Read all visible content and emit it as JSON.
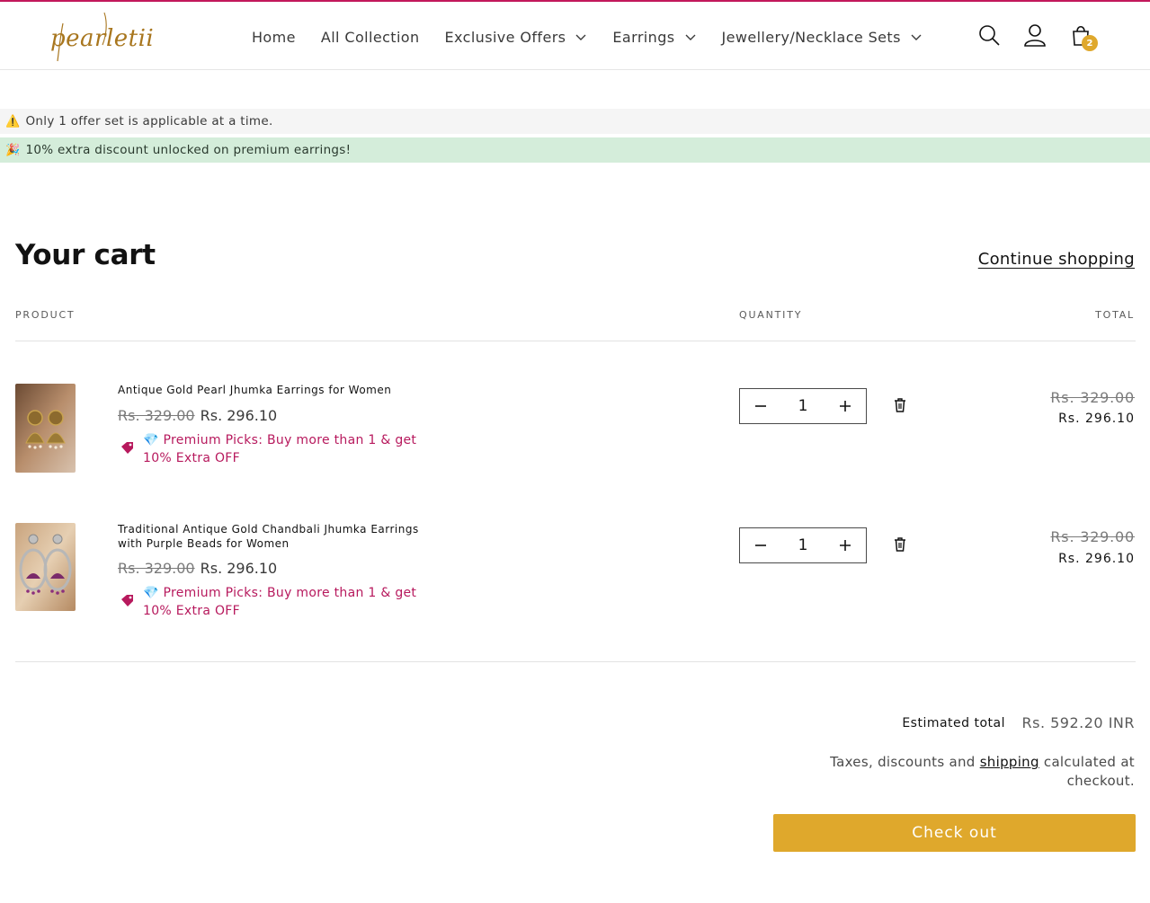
{
  "brand": {
    "logo_text": "pearletii",
    "accent": "#dfa82c",
    "promo_color": "#b7195d",
    "top_bar_color": "#c2185b"
  },
  "nav": {
    "items": [
      {
        "label": "Home",
        "has_dropdown": false
      },
      {
        "label": "All Collection",
        "has_dropdown": false
      },
      {
        "label": "Exclusive Offers",
        "has_dropdown": true
      },
      {
        "label": "Earrings",
        "has_dropdown": true
      },
      {
        "label": "Jewellery/Necklace Sets",
        "has_dropdown": true
      }
    ]
  },
  "header_icons": {
    "search": "search-icon",
    "account": "account-icon",
    "cart": "cart-icon",
    "cart_count": "2"
  },
  "notices": {
    "warning": {
      "emoji": "⚠️",
      "text": "Only 1 offer set is applicable at a time."
    },
    "success": {
      "emoji": "🎉",
      "text": "10% extra discount unlocked on premium earrings!"
    }
  },
  "cart": {
    "title": "Your cart",
    "continue_label": "Continue shopping",
    "columns": {
      "product": "PRODUCT",
      "quantity": "QUANTITY",
      "total": "TOTAL"
    },
    "items": [
      {
        "name": "Antique Gold Pearl Jhumka Earrings for Women",
        "compare_price": "Rs. 329.00",
        "price": "Rs. 296.10",
        "promo": "💎 Premium Picks: Buy more than 1 & get 10% Extra OFF",
        "quantity": "1",
        "total_old": "Rs. 329.00",
        "total_new": "Rs. 296.10"
      },
      {
        "name": "Traditional Antique Gold Chandbali Jhumka Earrings with Purple Beads for Women",
        "compare_price": "Rs. 329.00",
        "price": "Rs. 296.10",
        "promo": "💎 Premium Picks: Buy more than 1 & get 10% Extra OFF",
        "quantity": "1",
        "total_old": "Rs. 329.00",
        "total_new": "Rs. 296.10"
      }
    ]
  },
  "summary": {
    "estimated_label": "Estimated total",
    "estimated_value": "Rs. 592.20 INR",
    "tax_before": "Taxes, discounts and ",
    "tax_link": "shipping",
    "tax_after": " calculated at checkout.",
    "checkout_label": "Check out"
  }
}
